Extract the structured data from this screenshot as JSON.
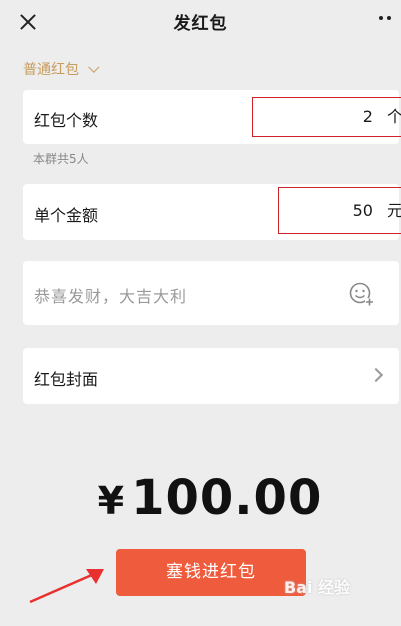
{
  "header": {
    "title": "发红包"
  },
  "packet_type": {
    "label": "普通红包"
  },
  "count_field": {
    "label": "红包个数",
    "value": "2",
    "unit": "个"
  },
  "group_hint": "本群共5人",
  "amount_field": {
    "label": "单个金额",
    "value": "50",
    "unit": "元"
  },
  "blessing": {
    "placeholder": "恭喜发财，大吉大利"
  },
  "cover": {
    "label": "红包封面"
  },
  "total": {
    "currency": "¥",
    "value": "100.00"
  },
  "send_button": {
    "label": "塞钱进红包"
  },
  "watermark": "Bai 经验",
  "colors": {
    "accent": "#ef5b3d",
    "highlight_box": "#d0202a",
    "gold_text": "#c89c5a",
    "background": "#ededed"
  }
}
